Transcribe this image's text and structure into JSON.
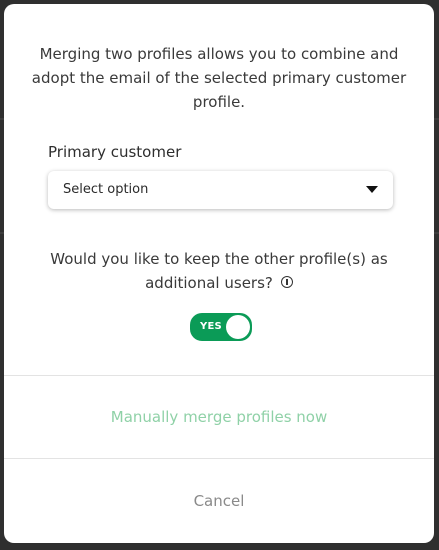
{
  "dialog": {
    "description": "Merging two profiles allows you to combine and adopt the email of the selected primary customer profile.",
    "primary_customer": {
      "label": "Primary customer",
      "value": "Select option",
      "caret_icon": "caret-down-icon"
    },
    "keep_profiles": {
      "question": "Would you like to keep the other profile(s) as additional users?",
      "info_icon": "info-circle-icon",
      "toggle_label": "YES",
      "toggle_on": true
    },
    "actions": {
      "merge_label": "Manually merge profiles now",
      "cancel_label": "Cancel"
    }
  },
  "colors": {
    "toggle_on": "#0b9b57",
    "merge_text": "#8fd1a7",
    "cancel_text": "#8a8a8a",
    "backdrop": "#2f2f2f"
  }
}
